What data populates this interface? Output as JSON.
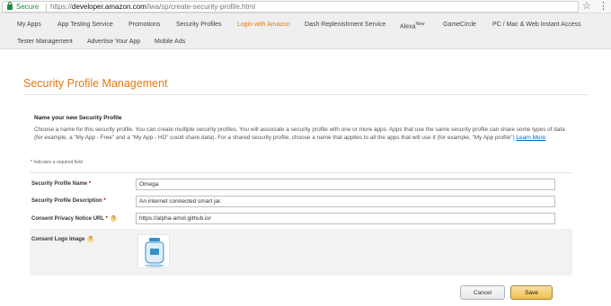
{
  "browser": {
    "secure_label": "Secure",
    "url_scheme": "https://",
    "url_host": "developer.amazon.com",
    "url_path": "/lwa/sp/create-security-profile.html"
  },
  "nav": {
    "row1": [
      "My Apps",
      "App Testing Service",
      "Promotions",
      "Security Profiles",
      "Login with Amazon",
      "Dash Replenishment Service",
      "Alexa",
      "GameCircle",
      "PC / Mac & Web Instant Access"
    ],
    "alexa_sup": "New",
    "row2": [
      "Tester Management",
      "Advertise Your App",
      "Mobile Ads"
    ],
    "active": "Login with Amazon"
  },
  "page": {
    "title": "Security Profile Management"
  },
  "section": {
    "heading": "Name your new Security Profile",
    "description": "Choose a name for this security profile. You can create multiple security profiles. You will associate a security profile with one or more apps. Apps that use the same security profile can share some types of data (for example, a \"My App - Free\" and a \"My App - HD\" could share data). For a shared security profile, choose a name that applies to all the apps that will use it (for example, \"My App profile\")",
    "learn_more": "Learn More",
    "required_star": "*",
    "required_note": "Indicates a required field"
  },
  "form": {
    "name_label": "Security Profile Name",
    "name_value": "Omega",
    "desc_label": "Security Profile Description",
    "desc_value": "An internet connected smart jar.",
    "privacy_label": "Consent Privacy Notice URL",
    "privacy_value": "https://alpha-amol.github.io/",
    "logo_label": "Consent Logo Image",
    "required_mark": "*",
    "help_glyph": "?"
  },
  "buttons": {
    "cancel": "Cancel",
    "save": "Save"
  },
  "colors": {
    "accent": "#e47911",
    "link": "#0066c0",
    "save_button": "#f0c14b",
    "required": "#c40000",
    "secure": "#1e8e3e"
  },
  "icons": [
    "lock-icon",
    "star-icon",
    "menu-icon",
    "help-icon"
  ]
}
